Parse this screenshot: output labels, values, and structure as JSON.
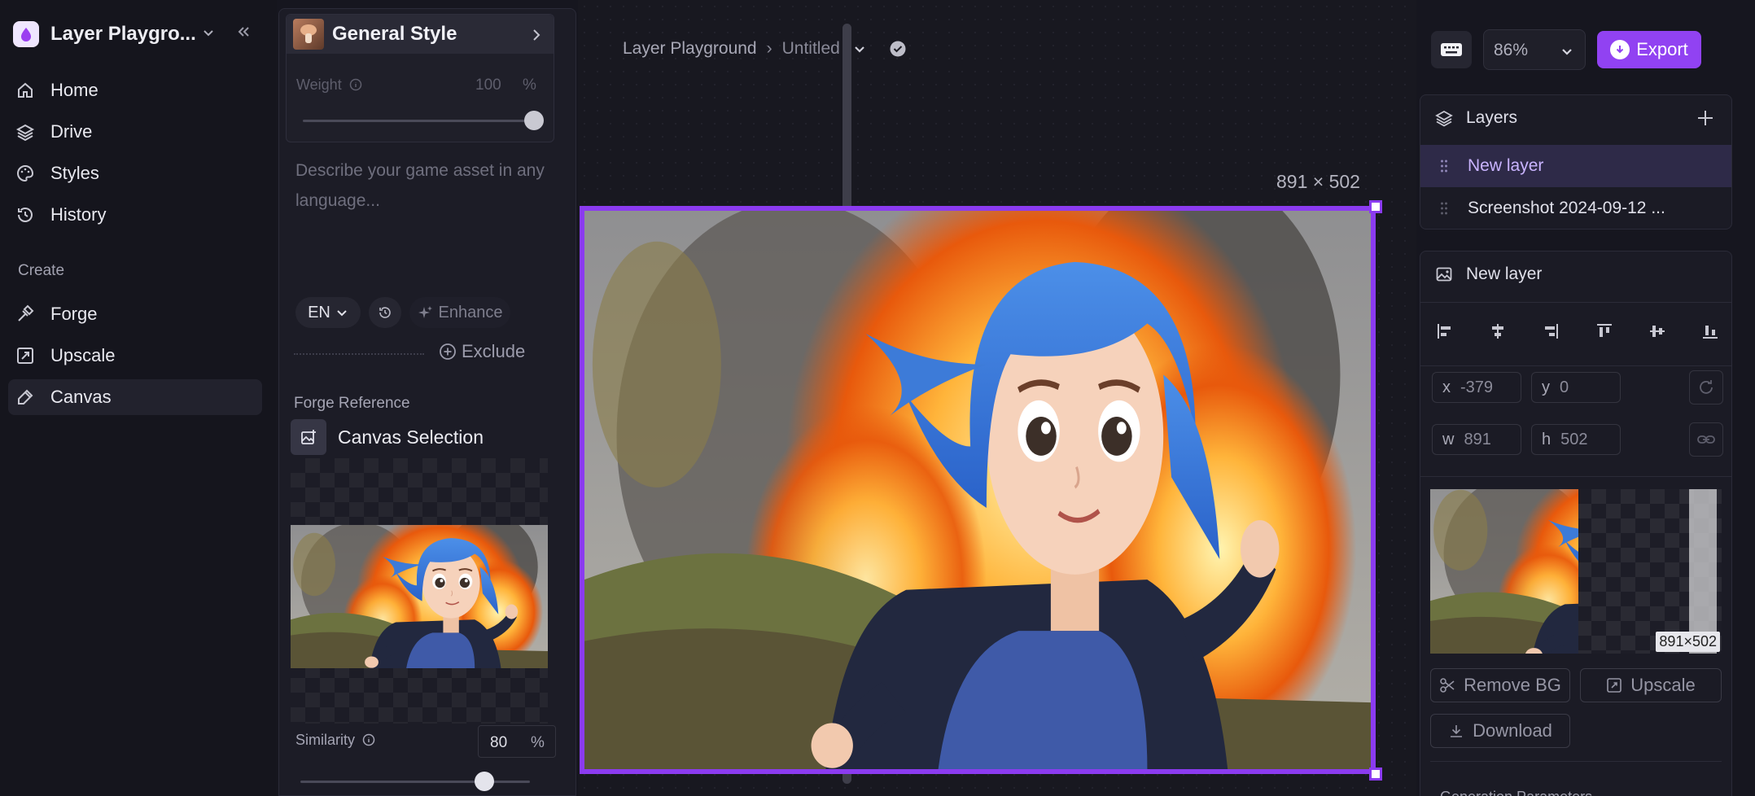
{
  "workspace": {
    "name": "Layer Playgro..."
  },
  "nav": {
    "primary": [
      {
        "id": "home",
        "label": "Home"
      },
      {
        "id": "drive",
        "label": "Drive"
      },
      {
        "id": "styles",
        "label": "Styles"
      },
      {
        "id": "history",
        "label": "History"
      }
    ],
    "section_label": "Create",
    "create": [
      {
        "id": "forge",
        "label": "Forge"
      },
      {
        "id": "upscale",
        "label": "Upscale"
      },
      {
        "id": "canvas",
        "label": "Canvas",
        "active": true
      }
    ]
  },
  "forge": {
    "style_name": "General Style",
    "weight_label": "Weight",
    "weight_value": "100",
    "weight_unit": "%",
    "weight_fraction": 1.0,
    "prompt_placeholder": "Describe your game asset in any language...",
    "language": "EN",
    "enhance_label": "Enhance",
    "exclude_label": "Exclude",
    "reference_label": "Forge Reference",
    "reference_source": "Canvas Selection",
    "similarity_label": "Similarity",
    "similarity_value": "80",
    "similarity_unit": "%",
    "similarity_fraction": 0.8
  },
  "breadcrumb": {
    "project": "Layer Playground",
    "separator": "›",
    "file": "Untitled"
  },
  "canvas": {
    "dimensions_label": "891 × 502"
  },
  "toolbar": {
    "zoom": "86%",
    "export_label": "Export"
  },
  "layers": {
    "title": "Layers",
    "items": [
      {
        "name": "New layer",
        "selected": true
      },
      {
        "name": "Screenshot 2024-09-12 ...",
        "selected": false
      }
    ]
  },
  "properties": {
    "title": "New layer",
    "x_label": "x",
    "x": "-379",
    "y_label": "y",
    "y": "0",
    "w_label": "w",
    "w": "891",
    "h_label": "h",
    "h": "502",
    "thumb_badge": "891×502",
    "remove_bg_label": "Remove BG",
    "upscale_label": "Upscale",
    "download_label": "Download",
    "generation_params_label": "Generation Parameters"
  },
  "colors": {
    "accent": "#8b3bf0",
    "export": "#9142f2",
    "selected_layer": "#2e2a48"
  }
}
